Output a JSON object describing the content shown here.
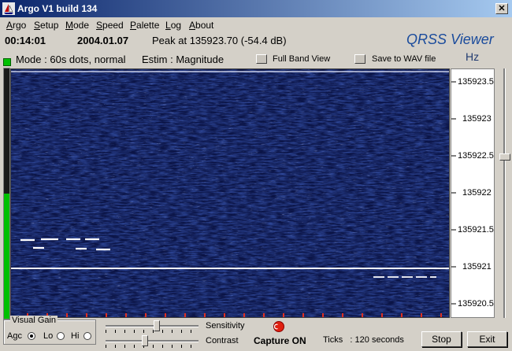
{
  "window": {
    "title": "Argo V1 build 134",
    "close_glyph": "✕"
  },
  "menu": [
    {
      "label": "Argo"
    },
    {
      "label": "Setup"
    },
    {
      "label": "Mode"
    },
    {
      "label": "Speed"
    },
    {
      "label": "Palette"
    },
    {
      "label": "Log"
    },
    {
      "label": "About"
    }
  ],
  "info": {
    "time": "00:14:01",
    "date": "2004.01.07",
    "peak": "Peak at 135923.70 (-54.4 dB)",
    "brand": "QRSS Viewer",
    "unit": "Hz"
  },
  "status": {
    "mode": "Mode : 60s dots, normal",
    "estim": "Estim : Magnitude",
    "full_band": "Full Band View",
    "save_wav": "Save to WAV file"
  },
  "axis": {
    "labels": [
      "135923.5",
      "135923",
      "135922.5",
      "135922",
      "135921.5",
      "135921",
      "135920.5"
    ]
  },
  "signal_level": 0.5,
  "controls": {
    "visual_gain": "Visual Gain",
    "agc": "Agc",
    "lo": "Lo",
    "hi": "Hi",
    "sensitivity": "Sensitivity",
    "contrast": "Contrast",
    "sensitivity_value": 0.55,
    "contrast_value": 0.42,
    "freq_slider_value": 0.35,
    "capture": "Capture ON",
    "ticks": "Ticks   : 120 seconds",
    "stop": "Stop",
    "exit": "Exit"
  },
  "colors": {
    "title_start": "#0a246a",
    "title_end": "#a6caf0",
    "spectro_bg": "#0b1446",
    "led": "#00c000",
    "capture": "#e02010"
  }
}
